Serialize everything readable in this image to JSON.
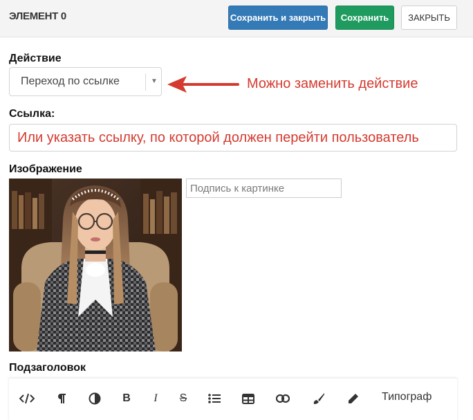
{
  "header": {
    "title": "ЭЛЕМЕНТ 0",
    "buttons": {
      "save_close": "Сохранить и закрыть",
      "save": "Сохранить",
      "close": "ЗАКРЫТЬ"
    }
  },
  "form": {
    "action": {
      "label": "Действие",
      "value": "Переход по ссылке",
      "annotation": "Можно заменить действие"
    },
    "link": {
      "label": "Ссылка:",
      "value": "Или указать ссылку, по которой должен перейти пользователь"
    },
    "image": {
      "label": "Изображение",
      "caption_placeholder": "Подпись к картинке"
    },
    "subtitle": {
      "label": "Подзаголовок"
    }
  },
  "toolbar": {
    "icons": [
      "code-icon",
      "paragraph-icon",
      "contrast-icon",
      "bold-icon",
      "italic-icon",
      "strikethrough-icon",
      "bulleted-list-icon",
      "table-icon",
      "link-icon",
      "brush-icon",
      "pencil-icon"
    ],
    "bold_glyph": "B",
    "italic_glyph": "I",
    "strike_glyph": "S",
    "typograph": "Типограф"
  },
  "colors": {
    "primary": "#337ab7",
    "success": "#1f9b5f",
    "annotation": "#d43a2f"
  }
}
